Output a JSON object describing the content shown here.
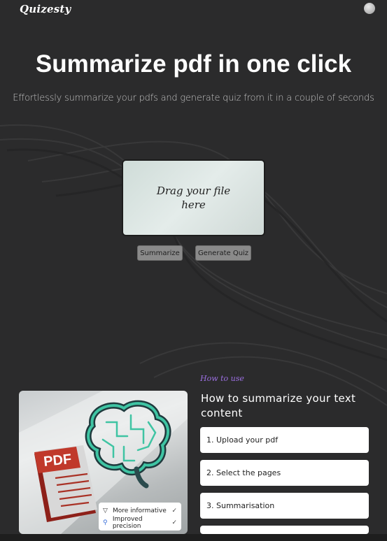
{
  "header": {
    "logo_text": "Quizesty",
    "theme_toggle_icon": "moon-icon"
  },
  "hero": {
    "title": "Summarize pdf in one click",
    "subtitle": "Effortlessly summarize your pdfs and generate quiz from it in a couple of seconds"
  },
  "upload": {
    "dropzone_text": "Drag your file here",
    "summarize_label": "Summarize",
    "quiz_label": "Generate Quiz"
  },
  "howto": {
    "label": "How to use",
    "title": "How to summarize your text content",
    "accent_color": "#9b6fe0",
    "steps": [
      {
        "label": "1. Upload your pdf"
      },
      {
        "label": "2. Select the pages"
      },
      {
        "label": "3. Summarisation"
      },
      {
        "label": ""
      }
    ]
  },
  "illustration": {
    "pdf_label": "PDF",
    "tags": [
      {
        "icon": "filter-icon",
        "label": "More informative",
        "check": "✓"
      },
      {
        "icon": "search-icon",
        "label": "Improved precision",
        "check": "✓"
      }
    ]
  }
}
